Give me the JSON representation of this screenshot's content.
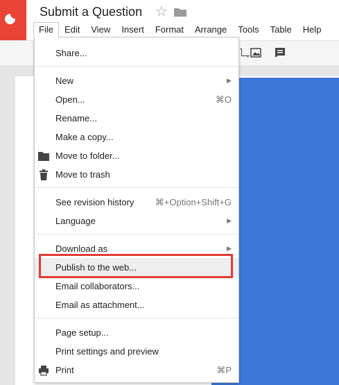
{
  "app": {
    "doc_title": "Submit a Question"
  },
  "menubar": [
    "File",
    "Edit",
    "View",
    "Insert",
    "Format",
    "Arrange",
    "Tools",
    "Table",
    "Help"
  ],
  "file_menu": {
    "share": "Share...",
    "new": "New",
    "open": "Open...",
    "open_shortcut": "⌘O",
    "rename": "Rename...",
    "make_copy": "Make a copy...",
    "move_to_folder": "Move to folder...",
    "move_to_trash": "Move to trash",
    "revision_history": "See revision history",
    "revision_shortcut": "⌘+Option+Shift+G",
    "language": "Language",
    "download_as": "Download as",
    "publish": "Publish to the web...",
    "email_collaborators": "Email collaborators...",
    "email_attachment": "Email as attachment...",
    "page_setup": "Page setup...",
    "print_settings": "Print settings and preview",
    "print": "Print",
    "print_shortcut": "⌘P"
  },
  "colors": {
    "logo": "#e94335",
    "slide": "#3c78d8",
    "highlight": "#e53935"
  }
}
